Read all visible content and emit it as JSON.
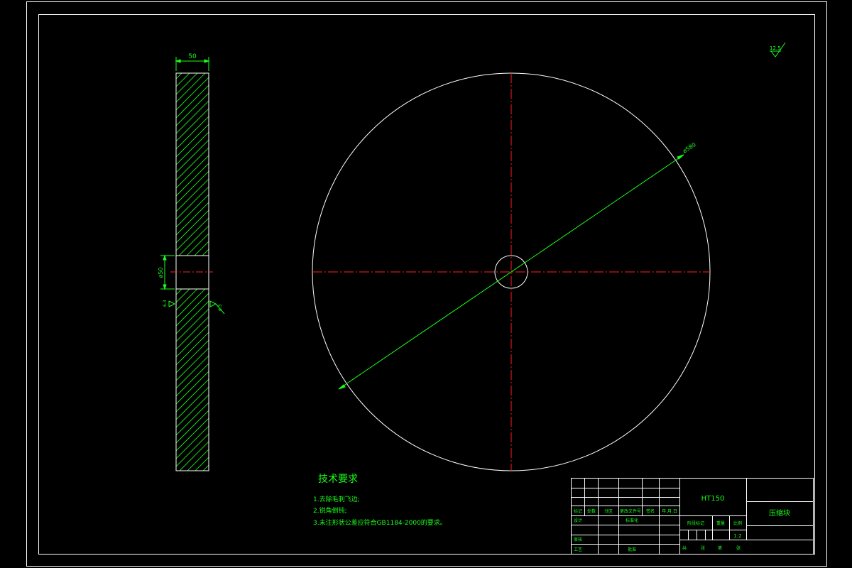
{
  "drawing": {
    "part_name": "压缩块",
    "material": "HT150",
    "scale": "1:2",
    "roughness_general": "12.5",
    "dimensions": {
      "thickness": "50",
      "hole_diameter": "ø50",
      "outer_diameter": "ø580"
    }
  },
  "tech_requirements": {
    "title": "技术要求",
    "items": [
      "1.去除毛刺飞边;",
      "2.锐角倒钝;",
      "3.未注形状公差应符合GB1184-2000的要求。"
    ]
  },
  "title_block": {
    "col_labels": [
      "标记",
      "处数",
      "分区",
      "更改文件号",
      "签名",
      "年.月.日"
    ],
    "row_labels": [
      "设计",
      "审核",
      "工艺"
    ],
    "standardize": "标准化",
    "approve": "批准",
    "stage_mark": "阶段标记",
    "weight": "重量",
    "scale_label": "比例",
    "sheet_labels": [
      "共",
      "张",
      "第",
      "张"
    ]
  },
  "colors": {
    "outline": "#ffffff",
    "annotation": "#1aff1a",
    "centerline": "#ff2020"
  }
}
